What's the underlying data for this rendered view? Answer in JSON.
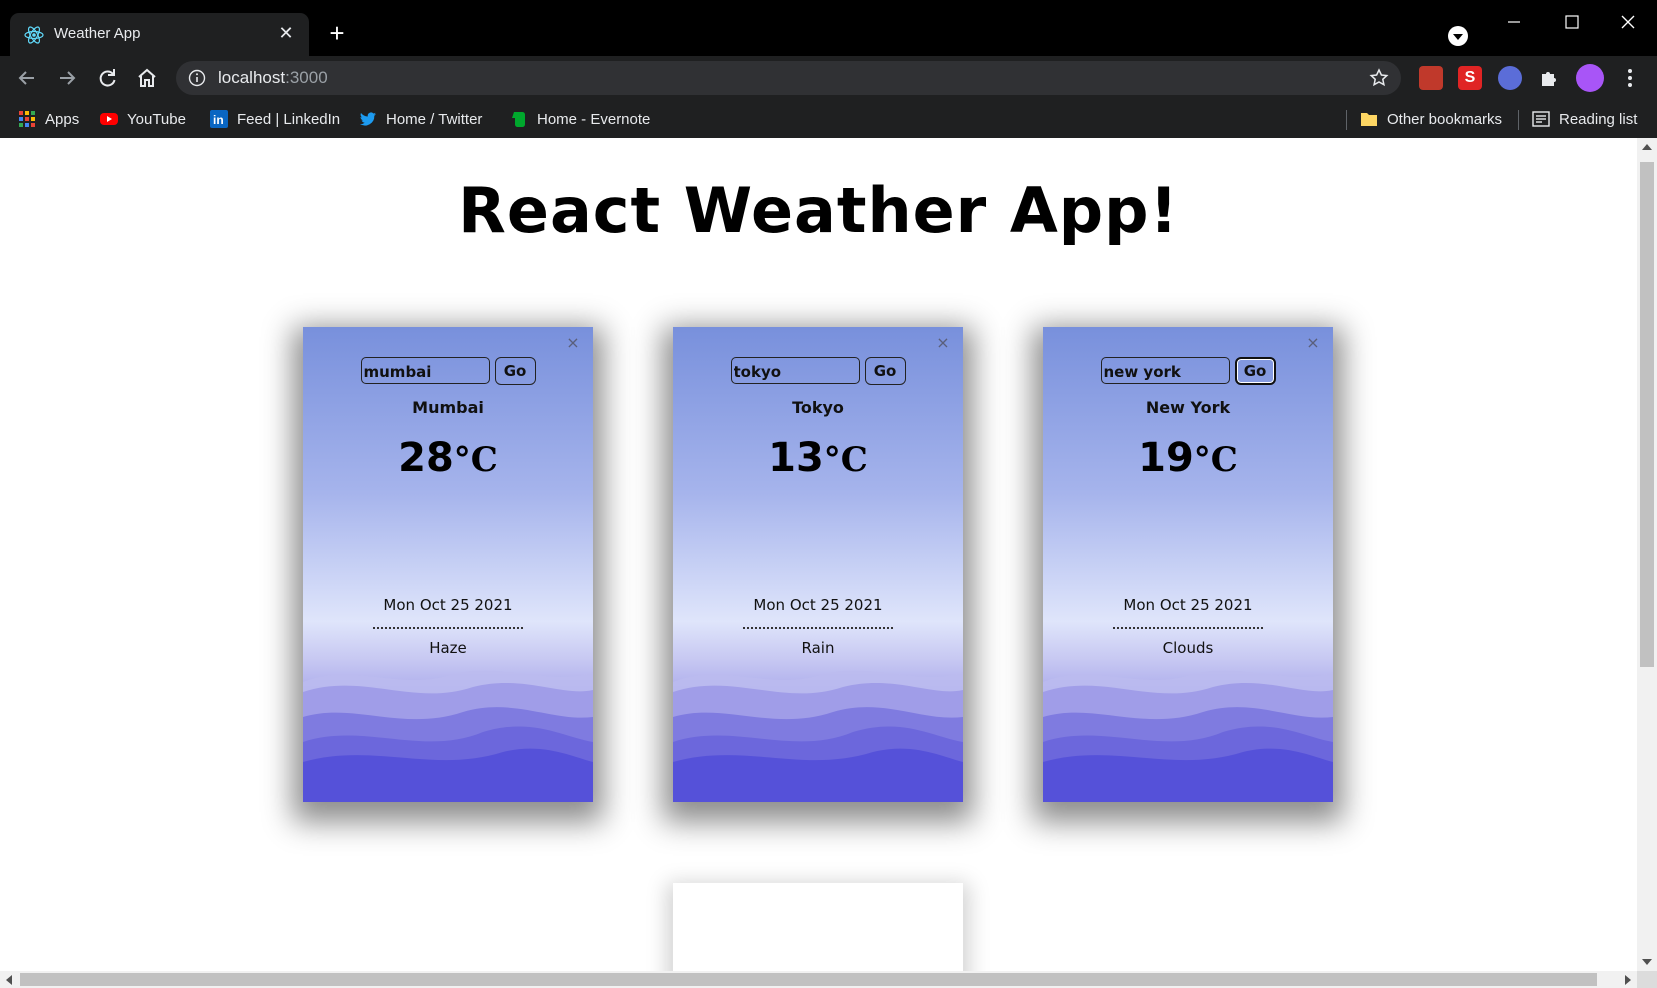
{
  "browser": {
    "tab": {
      "title": "Weather App",
      "favicon": "react-atom-icon"
    },
    "url": {
      "host": "localhost",
      "port": ":3000"
    },
    "bookmarks": [
      {
        "label": "Apps",
        "icon": "apps-grid-icon"
      },
      {
        "label": "YouTube",
        "icon": "youtube-icon"
      },
      {
        "label": "Feed | LinkedIn",
        "icon": "linkedin-icon"
      },
      {
        "label": "Home / Twitter",
        "icon": "twitter-icon"
      },
      {
        "label": "Home - Evernote",
        "icon": "evernote-icon"
      }
    ],
    "other_bookmarks": "Other bookmarks",
    "reading_list": "Reading list"
  },
  "page": {
    "title": "React Weather App!",
    "cards": [
      {
        "input_value": "mumbai",
        "go_label": "Go",
        "city": "Mumbai",
        "temp": "28",
        "unit": "°C",
        "date": "Mon Oct 25 2021",
        "condition": "Haze",
        "close": "×"
      },
      {
        "input_value": "tokyo",
        "go_label": "Go",
        "city": "Tokyo",
        "temp": "13",
        "unit": "°C",
        "date": "Mon Oct 25 2021",
        "condition": "Rain",
        "close": "×"
      },
      {
        "input_value": "new york",
        "go_label": "Go",
        "city": "New York",
        "temp": "19",
        "unit": "°C",
        "date": "Mon Oct 25 2021",
        "condition": "Clouds",
        "close": "×"
      }
    ]
  },
  "colors": {
    "chrome_dark": "#1f2021",
    "card_top": "#7890dc",
    "card_bottom": "#5551d9"
  }
}
